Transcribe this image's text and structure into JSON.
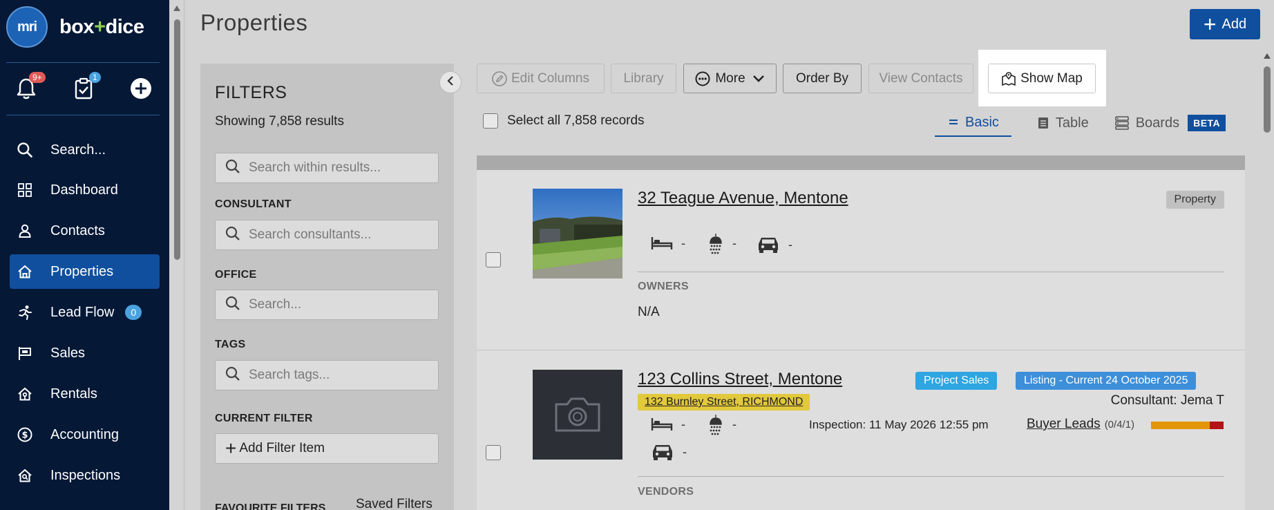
{
  "brand": {
    "logo_text": "mri",
    "name_a": "box",
    "name_plus": "+",
    "name_b": "dice"
  },
  "quick": {
    "notifications_badge": "9+",
    "tasks_badge": "1"
  },
  "nav": {
    "search": "Search...",
    "items": [
      {
        "label": "Dashboard",
        "icon": "grid-icon"
      },
      {
        "label": "Contacts",
        "icon": "person-icon"
      },
      {
        "label": "Properties",
        "icon": "house-icon",
        "active": true
      },
      {
        "label": "Lead Flow",
        "icon": "runner-icon",
        "badge": "0"
      },
      {
        "label": "Sales",
        "icon": "sign-icon"
      },
      {
        "label": "Rentals",
        "icon": "house-key-icon"
      },
      {
        "label": "Accounting",
        "icon": "dollar-icon"
      },
      {
        "label": "Inspections",
        "icon": "house-search-icon"
      }
    ]
  },
  "header": {
    "title": "Properties",
    "add_label": "Add"
  },
  "filters": {
    "title": "FILTERS",
    "count": "Showing 7,858 results",
    "search_placeholder": "Search within results...",
    "consultant_label": "CONSULTANT",
    "consultant_placeholder": "Search consultants...",
    "office_label": "OFFICE",
    "office_placeholder": "Search...",
    "tags_label": "TAGS",
    "tags_placeholder": "Search tags...",
    "current_label": "CURRENT FILTER",
    "add_filter_label": "Add Filter Item",
    "favourite_label": "FAVOURITE FILTERS",
    "saved_label": "Saved Filters"
  },
  "toolbar": {
    "edit_columns": "Edit Columns",
    "library": "Library",
    "more": "More",
    "order_by": "Order By",
    "view_contacts": "View Contacts",
    "show_map": "Show Map",
    "select_all": "Select all 7,858 records"
  },
  "views": {
    "basic": "Basic",
    "table": "Table",
    "boards": "Boards",
    "beta": "BETA"
  },
  "properties": [
    {
      "address": "32 Teague Avenue, Mentone",
      "tag": "Property",
      "beds": "-",
      "baths": "-",
      "cars": "-",
      "owners_label": "OWNERS",
      "owners_value": "N/A"
    },
    {
      "address": "123 Collins Street, Mentone",
      "linked_address": "132 Burnley Street, RICHMOND",
      "tag_a": "Project Sales",
      "tag_b": "Listing - Current 24 October 2025",
      "consultant": "Consultant: Jema T",
      "inspection": "Inspection: 11 May 2026 12:55 pm",
      "buyer_leads_label": "Buyer Leads",
      "buyer_leads_counts": "(0/4/1)",
      "beds": "-",
      "baths": "-",
      "cars": "-",
      "vendors_label": "VENDORS"
    }
  ],
  "colors": {
    "sidebar": "#051836",
    "accent": "#0f4f9e",
    "badge_red": "#e05a57",
    "badge_blue": "#4aa3df"
  }
}
